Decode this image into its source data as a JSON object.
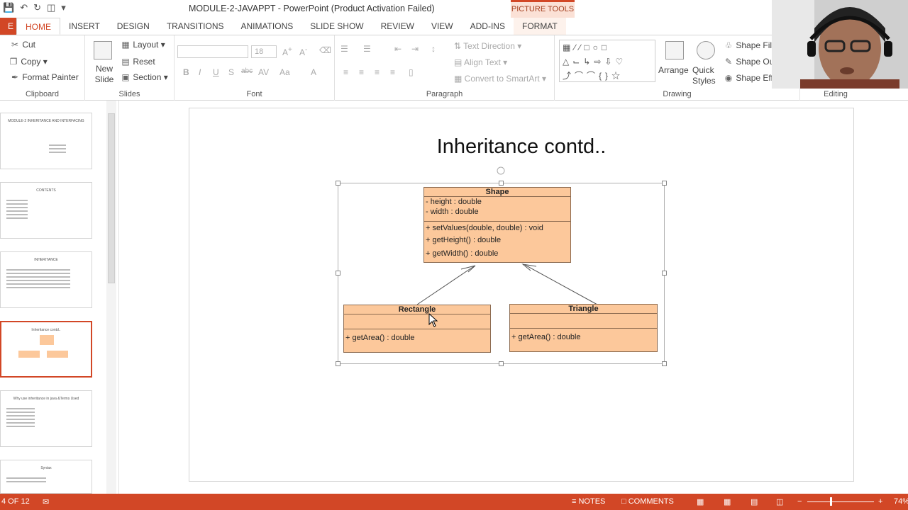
{
  "window": {
    "title": "MODULE-2-JAVAPPT - PowerPoint (Product Activation Failed)",
    "picture_tools": "PICTURE TOOLS"
  },
  "tabs": [
    "FILE",
    "HOME",
    "INSERT",
    "DESIGN",
    "TRANSITIONS",
    "ANIMATIONS",
    "SLIDE SHOW",
    "REVIEW",
    "VIEW",
    "ADD-INS",
    "FORMAT"
  ],
  "clipboard": {
    "cut": "Cut",
    "copy": "Copy",
    "format_painter": "Format Painter",
    "label": "Clipboard"
  },
  "slides_group": {
    "new_slide": "New Slide",
    "layout": "Layout",
    "reset": "Reset",
    "section": "Section",
    "label": "Slides"
  },
  "font_group": {
    "size": "18",
    "label": "Font"
  },
  "paragraph_group": {
    "text_direction": "Text Direction",
    "align_text": "Align Text",
    "convert": "Convert to SmartArt",
    "label": "Paragraph"
  },
  "drawing_group": {
    "arrange": "Arrange",
    "quick_styles": "Quick Styles",
    "shape_fill": "Shape Fill",
    "shape_outline": "Shape Ou",
    "shape_effects": "Shape Effe",
    "label": "Drawing"
  },
  "editing_group": {
    "label": "Editing"
  },
  "thumbnails": [
    {
      "title": "MODULE-2 INHERITANCE AND INTERFACING"
    },
    {
      "title": "CONTENTS"
    },
    {
      "title": "INHERITANCE"
    },
    {
      "title": "Inheritance contd.."
    },
    {
      "title": "Why use inheritance in java &Terms Used"
    },
    {
      "title": "Syntax"
    }
  ],
  "slide": {
    "title": "Inheritance contd..",
    "shape": {
      "name": "Shape",
      "attrs": [
        "- height : double",
        "- width : double"
      ],
      "methods": [
        "+ setValues(double, double) : void",
        "+ getHeight() : double",
        "+ getWidth() : double"
      ]
    },
    "rectangle": {
      "name": "Rectangle",
      "methods": [
        "+ getArea() : double"
      ]
    },
    "triangle": {
      "name": "Triangle",
      "methods": [
        "+ getArea() : double"
      ]
    }
  },
  "status": {
    "slide_info": "4 OF 12",
    "notes": "NOTES",
    "comments": "COMMENTS",
    "zoom": "74%"
  }
}
